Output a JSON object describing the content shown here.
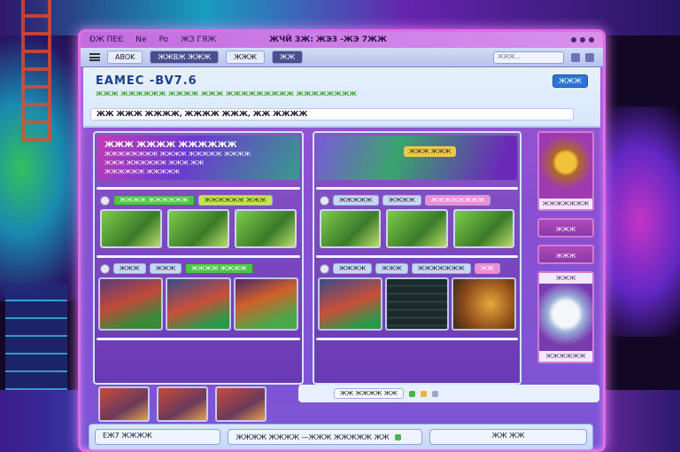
{
  "titlebar": {
    "left_items": [
      "ÐЖ ПЕЄ",
      "Ne",
      "Po",
      "ЖЗ ГЯЖ"
    ],
    "center": "ЖЧЙ  ЗЖ: ЖЭЗ  -ЖЭ 7ЖЖ"
  },
  "toolbar": {
    "items": [
      "ABOK",
      "ЖЖВЖ ЖЖЖ",
      "ЖЖЖ",
      "ЖЖ"
    ],
    "search_placeholder": "ЖЖЖ..."
  },
  "header": {
    "brand": "EAMEC -BV7.6",
    "subtitle": "ЖЖЖ ЖЖЖЖЖЖ ЖЖЖЖ ЖЖЖ ЖЖЖЖЖЖЖЖЖ ЖЖЖЖЖЖЖЖ",
    "button": "ЖЖЖ",
    "headline": "ЖЖ ЖЖЖ ЖЖЖЖ,  ЖЖЖЖ ЖЖЖ,  ЖЖ ЖЖЖЖ"
  },
  "left_panel": {
    "banner_title": "ЖЖЖ ЖЖЖЖ ЖЖЖЖЖЖ",
    "banner_lines": [
      "ЖЖЖЖЖЖЖЖ ЖЖЖЖ ЖЖЖЖЖ ЖЖЖЖ",
      "ЖЖЖ ЖЖЖЖЖЖ ЖЖЖ ЖЖ",
      "ЖЖЖЖЖЖ ЖЖЖЖЖ"
    ],
    "tags": [
      "ЖЖЖЖ ЖЖЖЖЖЖ",
      "ЖЖЖЖЖЖ ЖЖЖ"
    ],
    "tags2": [
      "ЖЖЖ",
      "ЖЖЖ",
      "ЖЖЖЖ ЖЖЖЖ"
    ]
  },
  "mid_panel": {
    "banner_pill": "ЖЖЖ ЖЖЖ",
    "tags": [
      "ЖЖЖЖЖ",
      "ЖЖЖЖ",
      "ЖЖЖЖЖЖЖЖ"
    ],
    "tags2": [
      "ЖЖЖЖ",
      "ЖЖЖ",
      "ЖЖЖЖЖЖЖ",
      "ЖЖ"
    ]
  },
  "bottom_strip": {
    "button": "ЖЖ ЖЖЖЖ ЖЖ"
  },
  "sidebar": {
    "item1_label": "ЖЖЖЖЖЖЖ",
    "item2": "ЖЖЖ",
    "item3": "ЖЖЖ",
    "item4_label": "ЖЖЖ",
    "item5_label": "ЖЖЖЖЖЖ"
  },
  "footer": {
    "field1": "ЕЖ7 ЖЖЖЖ",
    "field2": "ЖЖЖЖ ЖЖЖЖ —ЖЖЖ ЖЖЖЖЖ ЖЖ",
    "field3": "ЖЖ ЖЖ"
  },
  "colors": {
    "window_border": "#e36ae8",
    "accent_blue": "#2c74d6",
    "accent_green": "#4fc44a"
  }
}
